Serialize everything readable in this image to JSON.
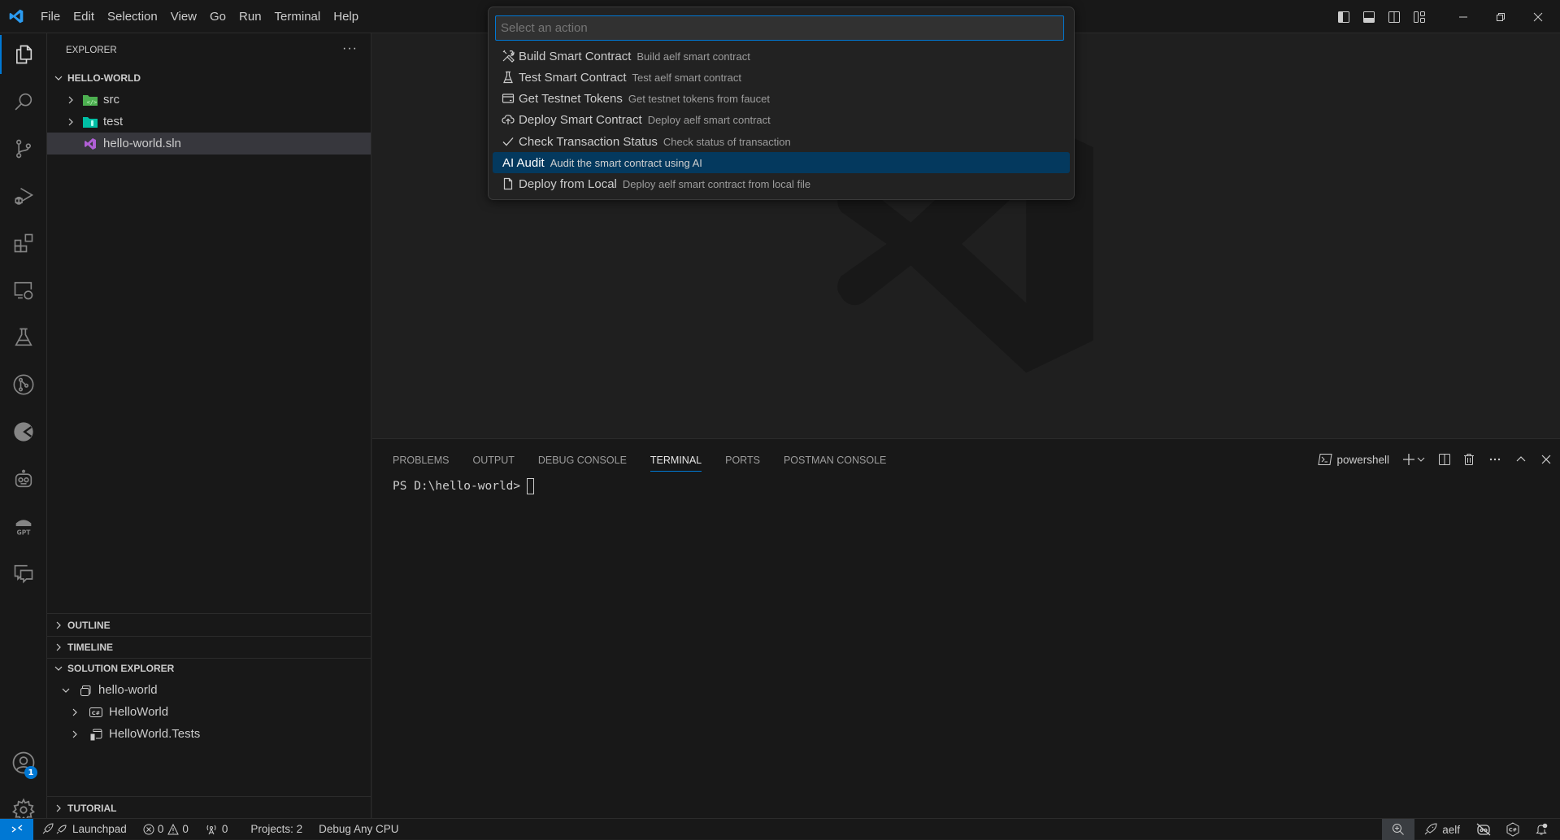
{
  "titlebar": {
    "menu": [
      "File",
      "Edit",
      "Selection",
      "View",
      "Go",
      "Run",
      "Terminal",
      "Help"
    ],
    "layout_icons": [
      "toggle-primary-sidebar-icon",
      "toggle-panel-icon",
      "toggle-secondary-sidebar-icon",
      "customize-layout-icon"
    ],
    "window_controls": [
      "minimize",
      "restore",
      "close"
    ]
  },
  "activity_bar": {
    "items": [
      "explorer",
      "search",
      "source-control",
      "run-and-debug",
      "extensions",
      "remote-explorer",
      "testing",
      "git-graph",
      "aelf",
      "copilot-bot",
      "gpt",
      "chat"
    ],
    "bottom": [
      "accounts",
      "manage"
    ],
    "accounts_badge": "1"
  },
  "sidebar": {
    "title": "EXPLORER",
    "more": "···",
    "workspace": "HELLO-WORLD",
    "tree": [
      {
        "label": "src",
        "type": "folder",
        "collapsed": true
      },
      {
        "label": "test",
        "type": "folder",
        "collapsed": true
      },
      {
        "label": "hello-world.sln",
        "type": "file",
        "selected": true
      }
    ],
    "sections": {
      "outline": "OUTLINE",
      "timeline": "TIMELINE",
      "solution_explorer": "SOLUTION EXPLORER",
      "tutorial": "TUTORIAL"
    },
    "solution": {
      "root": "hello-world",
      "projects": [
        "HelloWorld",
        "HelloWorld.Tests"
      ]
    }
  },
  "command_palette": {
    "placeholder": "Select an action",
    "items": [
      {
        "icon": "tools",
        "label": "Build Smart Contract",
        "description": "Build aelf smart contract"
      },
      {
        "icon": "beaker",
        "label": "Test Smart Contract",
        "description": "Test aelf smart contract"
      },
      {
        "icon": "credit-card",
        "label": "Get Testnet Tokens",
        "description": "Get testnet tokens from faucet"
      },
      {
        "icon": "cloud-upload",
        "label": "Deploy Smart Contract",
        "description": "Deploy aelf smart contract"
      },
      {
        "icon": "check",
        "label": "Check Transaction Status",
        "description": "Check status of transaction"
      },
      {
        "icon": "",
        "label": "AI Audit",
        "description": "Audit the smart contract using AI",
        "selected": true
      },
      {
        "icon": "file",
        "label": "Deploy from Local",
        "description": "Deploy aelf smart contract from local file"
      }
    ]
  },
  "panel": {
    "tabs": [
      "PROBLEMS",
      "OUTPUT",
      "DEBUG CONSOLE",
      "TERMINAL",
      "PORTS",
      "POSTMAN CONSOLE"
    ],
    "active_tab": "TERMINAL",
    "terminal_name": "powershell",
    "prompt": "PS D:\\hello-world>"
  },
  "statusbar": {
    "launchpad": "Launchpad",
    "errors": "0",
    "warnings": "0",
    "ports": "0",
    "projects": "Projects: 2",
    "config": "Debug Any CPU",
    "aelf": "aelf"
  },
  "colors": {
    "accent": "#0078d4",
    "selection": "#04395e",
    "background": "#1f1f1f",
    "chrome": "#181818"
  }
}
